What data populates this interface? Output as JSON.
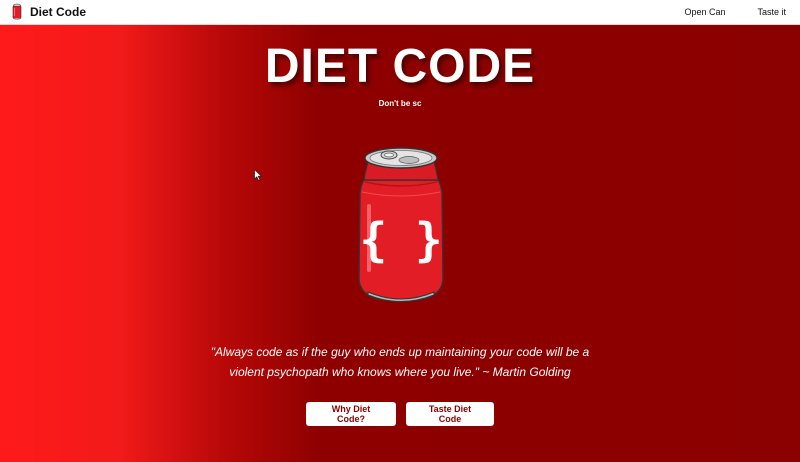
{
  "nav": {
    "brand": "Diet Code",
    "links": [
      "Open Can",
      "Taste it"
    ]
  },
  "hero": {
    "title": "DIET CODE",
    "subtitle": "Don't be sc",
    "can_symbol": "{ }",
    "quote": "\"Always code as if the guy who ends up maintaining your code will be a violent psychopath who knows where you live.\" ~ Martin Golding",
    "buttons": [
      "Why Diet Code?",
      "Taste Diet Code"
    ]
  },
  "colors": {
    "brand_red": "#8b0000",
    "bright_red": "#ff1a1a",
    "can_red": "#e21d26"
  },
  "icons": {
    "brand_logo": "soda-can-icon",
    "cursor": "mouse-pointer-icon"
  }
}
